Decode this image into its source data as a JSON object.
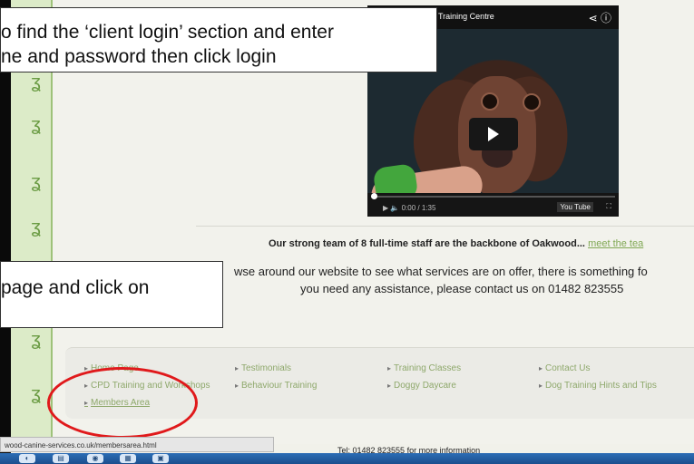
{
  "instructions": {
    "callout1": [
      "o find the ‘client login’ section and enter",
      "ne and password then click login"
    ],
    "callout2": "page and click on"
  },
  "video": {
    "title": "Training Centre",
    "share_icon": "share-icon",
    "info_icon": "info-icon",
    "play_icon": "play-icon",
    "time": "0:00 / 1:35",
    "youtube_label": "You Tube",
    "fullscreen_icon": "fullscreen-icon"
  },
  "content": {
    "team_text": "Our strong team of 8 full-time staff are the backbone of Oakwood...",
    "meet_link": "meet the tea",
    "browse_line": "wse around our website to see what services are on offer, there is something fo",
    "contact_line": "you need any assistance, please contact us on 01482 823555"
  },
  "footer_links": [
    "Home Page",
    "CPD Training and Workshops",
    "Members Area",
    "Testimonials",
    "Behaviour Training",
    "Training Classes",
    "Doggy Daycare",
    "Contact Us",
    "Dog Training Hints and Tips"
  ],
  "status_url": "wood-canine-services.co.uk/membersarea.html",
  "telephone": "Tel: 01482 823555 for more information",
  "colors": {
    "accent_green": "#8ea86b",
    "highlight_red": "#e0191b",
    "taskbar_blue": "#2c6db5"
  }
}
